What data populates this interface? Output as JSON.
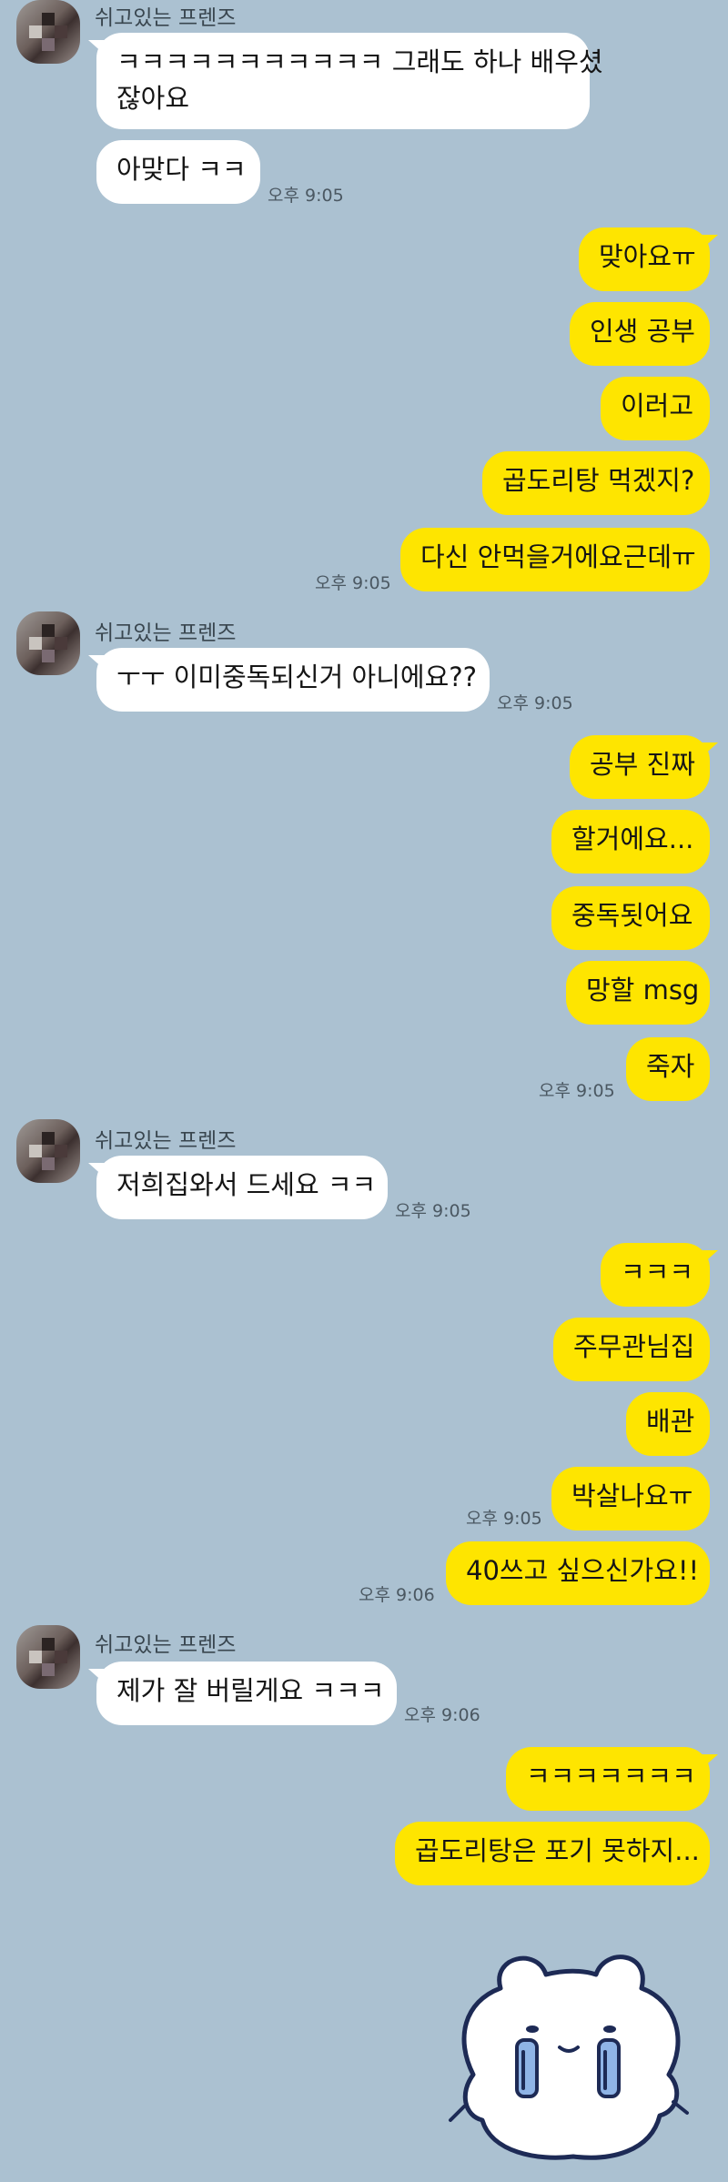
{
  "sender_name": "쉬고있는 프렌즈",
  "blocks": [
    {
      "sender": "쉬고있는 프렌즈",
      "messages": [
        {
          "line1": "ㅋㅋㅋㅋㅋㅋㅋㅋㅋㅋㅋ 그래도 하나 배우셨",
          "line2": "잖아요"
        },
        {
          "text": "아맞다 ㅋㅋ",
          "time": "오후 9:05"
        }
      ]
    },
    {
      "messages": [
        {
          "text": "맞아요ㅠ"
        },
        {
          "text": "인생 공부"
        },
        {
          "text": "이러고"
        },
        {
          "text": "곱도리탕 먹겠지?"
        },
        {
          "text": "다신 안먹을거에요근데ㅠ",
          "time": "오후 9:05"
        }
      ]
    },
    {
      "sender": "쉬고있는 프렌즈",
      "messages": [
        {
          "text": "ㅜㅜ 이미중독되신거 아니에요??",
          "time": "오후 9:05"
        }
      ]
    },
    {
      "messages": [
        {
          "text": "공부 진짜"
        },
        {
          "text": "할거에요..."
        },
        {
          "text": "중독됫어요"
        },
        {
          "text": "망할 msg"
        },
        {
          "text": "죽자",
          "time": "오후 9:05"
        }
      ]
    },
    {
      "sender": "쉬고있는 프렌즈",
      "messages": [
        {
          "text": "저희집와서 드세요 ㅋㅋ",
          "time": "오후 9:05"
        }
      ]
    },
    {
      "messages": [
        {
          "text": "ㅋㅋㅋ"
        },
        {
          "text": "주무관님집"
        },
        {
          "text": "배관"
        },
        {
          "text": "박살나요ㅠ",
          "time": "오후 9:05"
        },
        {
          "text": "40쓰고 싶으신가요!!",
          "time": "오후 9:06"
        }
      ]
    },
    {
      "sender": "쉬고있는 프렌즈",
      "messages": [
        {
          "text": "제가 잘 버릴게요 ㅋㅋㅋ",
          "time": "오후 9:06"
        }
      ]
    },
    {
      "messages": [
        {
          "text": "ㅋㅋㅋㅋㅋㅋㅋ"
        },
        {
          "text": "곱도리탕은 포기 못하지..."
        }
      ]
    }
  ],
  "sticker": {
    "icon": "crying-frog-sticker"
  },
  "colors": {
    "background": "#abc1d1",
    "incoming_bubble": "#ffffff",
    "outgoing_bubble": "#fee500"
  }
}
